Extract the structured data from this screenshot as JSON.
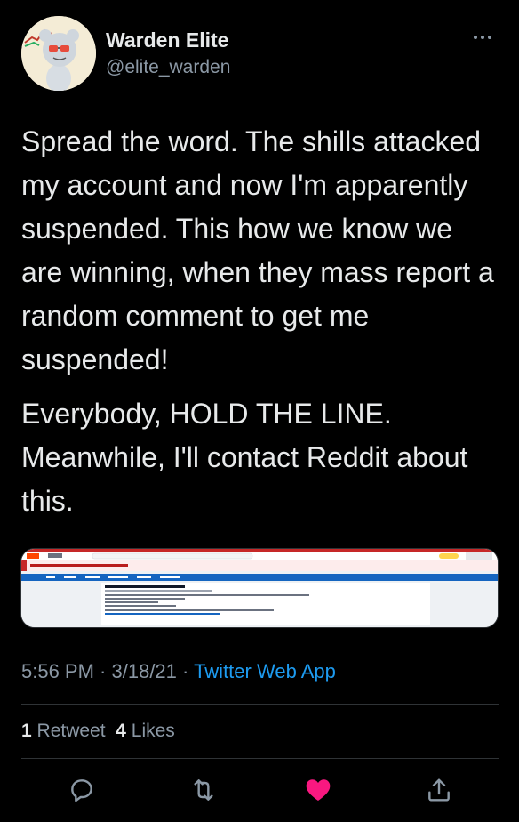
{
  "author": {
    "name": "Warden Elite",
    "handle": "@elite_warden"
  },
  "tweet": {
    "paragraphs": [
      "Spread the word. The shills attacked my account and now I'm apparently suspended. This how we know we are winning, when they mass report a random comment to get me suspended!",
      "Everybody, HOLD THE LINE. Meanwhile, I'll contact Reddit about this."
    ]
  },
  "meta": {
    "time": "5:56 PM",
    "sep1": " · ",
    "date": "3/18/21",
    "sep2": " · ",
    "app": "Twitter Web App"
  },
  "stats": {
    "retweets_count": "1",
    "retweets_label": "Retweet",
    "likes_count": "4",
    "likes_label": "Likes"
  },
  "actions": {
    "icons": [
      "reply-icon",
      "retweet-icon",
      "like-icon",
      "share-icon"
    ]
  },
  "colors": {
    "accent": "#1d9bf0",
    "like": "#f91880",
    "secondary": "#8b98a5",
    "divider": "#2f3336"
  },
  "embedded_image": {
    "description_note": ""
  }
}
